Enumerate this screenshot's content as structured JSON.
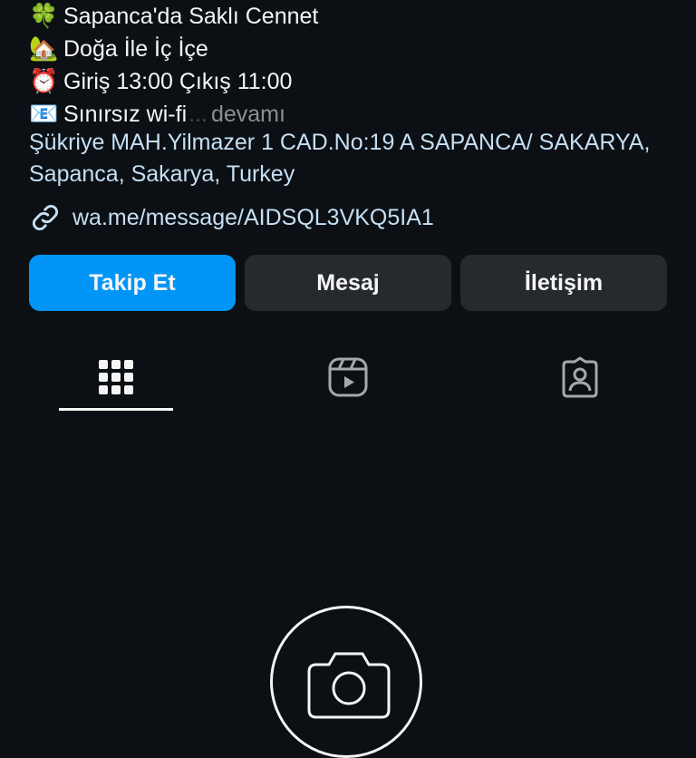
{
  "bio": {
    "lines": [
      {
        "emoji": "🍀",
        "icon": "clover-icon",
        "text": "Sapanca'da Saklı Cennet"
      },
      {
        "emoji": "🏡",
        "icon": "house-icon",
        "text": "Doğa İle İç İçe"
      },
      {
        "emoji": "⏰",
        "icon": "alarm-clock-icon",
        "text": "Giriş 13:00 Çıkış 11:00"
      },
      {
        "emoji": "📧",
        "icon": "mail-icon",
        "text": "Sınırsız wi-fi",
        "ellipsis": "...",
        "more_label": "devamı"
      }
    ]
  },
  "address": "Şükriye MAH.Yilmazer 1 CAD.No:19 A SAPANCA/ SAKARYA, Sapanca, Sakarya, Turkey",
  "link": {
    "icon": "link-icon",
    "text": "wa.me/message/AIDSQL3VKQ5IA1"
  },
  "buttons": {
    "follow_label": "Takip Et",
    "message_label": "Mesaj",
    "contact_label": "İletişim"
  },
  "tabs": {
    "items": [
      {
        "icon": "grid-icon",
        "selected": true
      },
      {
        "icon": "reels-icon",
        "selected": false
      },
      {
        "icon": "tagged-icon",
        "selected": false
      }
    ]
  },
  "empty_state": {
    "icon": "camera-icon"
  },
  "colors": {
    "background": "#0c1014",
    "accent": "#0095f6",
    "link": "#c6dff5",
    "secondary_button": "#262a2f",
    "muted": "#8e8e8e"
  }
}
